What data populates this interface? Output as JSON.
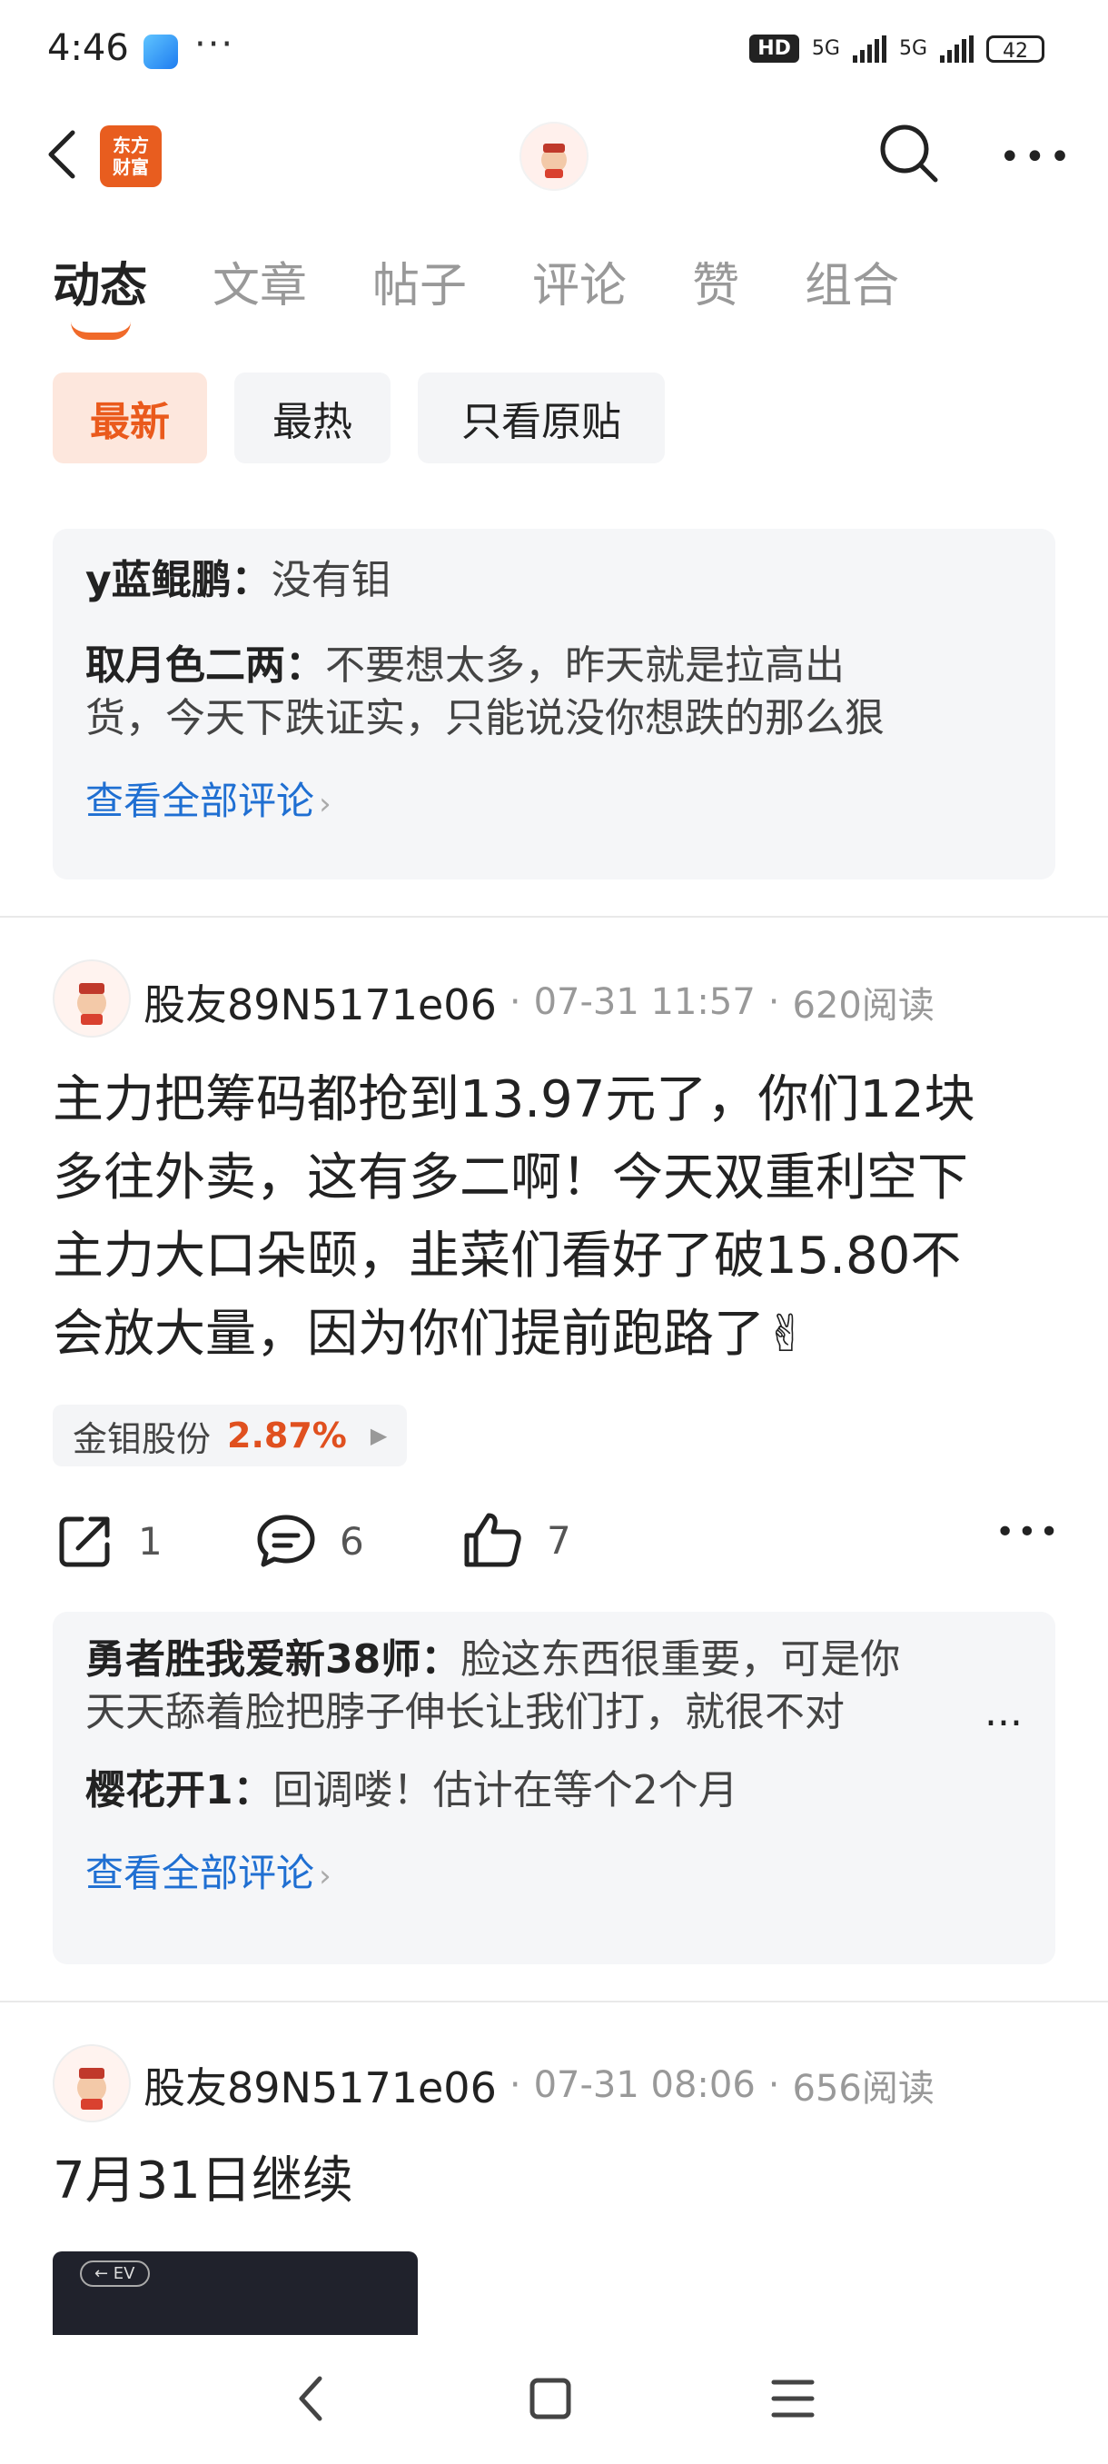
{
  "status": {
    "time": "4:46",
    "dots": "···",
    "hd": "HD",
    "net1": "5G",
    "net2": "5G",
    "battery": "42"
  },
  "nav": {
    "logo_line1": "东方",
    "logo_line2": "财富"
  },
  "tabs": [
    "动态",
    "文章",
    "帖子",
    "评论",
    "赞",
    "组合"
  ],
  "filters": [
    "最新",
    "最热",
    "只看原贴"
  ],
  "box1": {
    "c1_name": "y蓝鲲鹏：",
    "c1_text": "没有钼",
    "c2_name": "取月色二两：",
    "c2_text1": "不要想太多，昨天就是拉高出",
    "c2_text2": "货，今天下跌证实，只能说没你想跌的那么狠",
    "see_all": "查看全部评论"
  },
  "post1": {
    "author": "股友89N5171e06",
    "date": "07-31 11:57",
    "reads": "620阅读",
    "lines": [
      "主力把筹码都抢到13.97元了，你们12块",
      "多往外卖，这有多二啊！今天双重利空下",
      "主力大口朵颐，韭菜们看好了破15.80不",
      "会放大量，因为你们提前跑路了✌"
    ],
    "stock_name": "金钼股份",
    "stock_pct": "2.87%",
    "share_count": "1",
    "comment_count": "6",
    "like_count": "7"
  },
  "box2": {
    "c1_name": "勇者胜我爱新38师：",
    "c1_text1": "脸这东西很重要，可是你",
    "c1_text2": "天天舔着脸把脖子伸长让我们打，就很不对",
    "c1_more": "...",
    "c2_name": "樱花开1：",
    "c2_text": "回调喽！估计在等个2个月",
    "see_all": "查看全部评论"
  },
  "post2": {
    "author": "股友89N5171e06",
    "date": "07-31 08:06",
    "reads": "656阅读",
    "text": "7月31日继续",
    "thumb_label": "← EV"
  }
}
